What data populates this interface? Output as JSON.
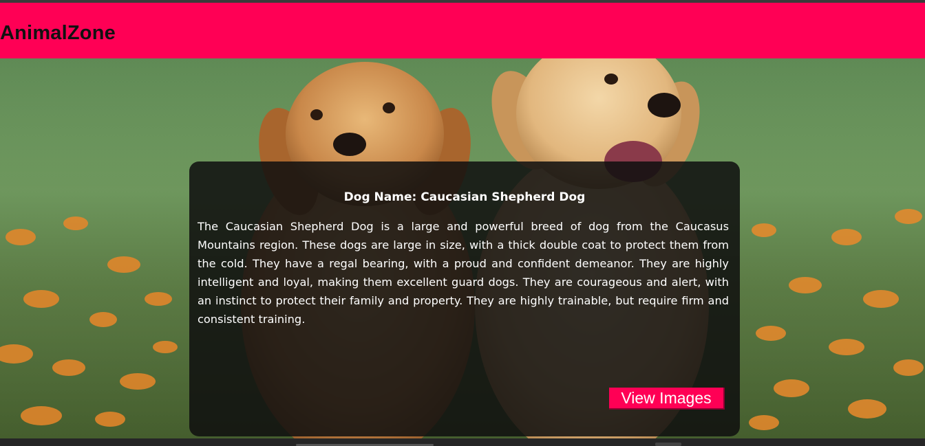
{
  "header": {
    "brand": "AnimalZone",
    "background_color": "#ff0055"
  },
  "hero": {
    "image_description_icon": "puppies-image"
  },
  "card": {
    "title": "Dog Name: Caucasian Shepherd Dog",
    "description": "The Caucasian Shepherd Dog is a large and powerful breed of dog from the Caucasus Mountains region. These dogs are large in size, with a thick double coat to protect them from the cold. They have a regal bearing, with a proud and confident demeanor. They are highly intelligent and loyal, making them excellent guard dogs. They are courageous and alert, with an instinct to protect their family and property. They are highly trainable, but require firm and consistent training.",
    "button_label": "View Images",
    "button_color": "#ff0055"
  }
}
